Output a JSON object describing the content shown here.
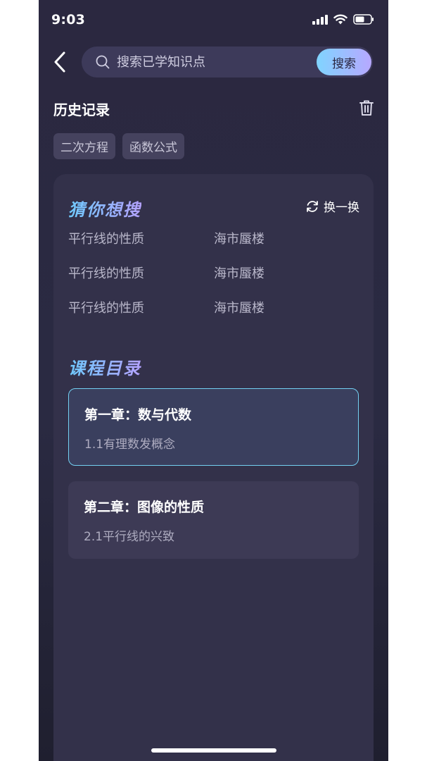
{
  "status_bar": {
    "time": "9:03"
  },
  "header": {
    "back_icon": "chevron-left-icon",
    "search_placeholder": "搜索已学知识点",
    "search_button": "搜索"
  },
  "history": {
    "title": "历史记录",
    "clear_icon": "trash-icon",
    "tags": [
      "二次方程",
      "函数公式"
    ]
  },
  "suggestions": {
    "title": "猜你想搜",
    "refresh_label": "换一换",
    "items": [
      "平行线的性质",
      "海市蜃楼",
      "平行线的性质",
      "海市蜃楼",
      "平行线的性质",
      "海市蜃楼"
    ]
  },
  "catalog": {
    "title": "课程目录",
    "chapters": [
      {
        "title": "第一章：数与代数",
        "subtitle": "1.1有理数发概念"
      },
      {
        "title": "第二章：图像的性质",
        "subtitle": "2.1平行线的兴致"
      }
    ]
  },
  "colors": {
    "background": "#2b2840",
    "card": "#33314a",
    "accent_start": "#6fcaff",
    "accent_end": "#b4a2ff",
    "active_border": "#73d0f2"
  }
}
